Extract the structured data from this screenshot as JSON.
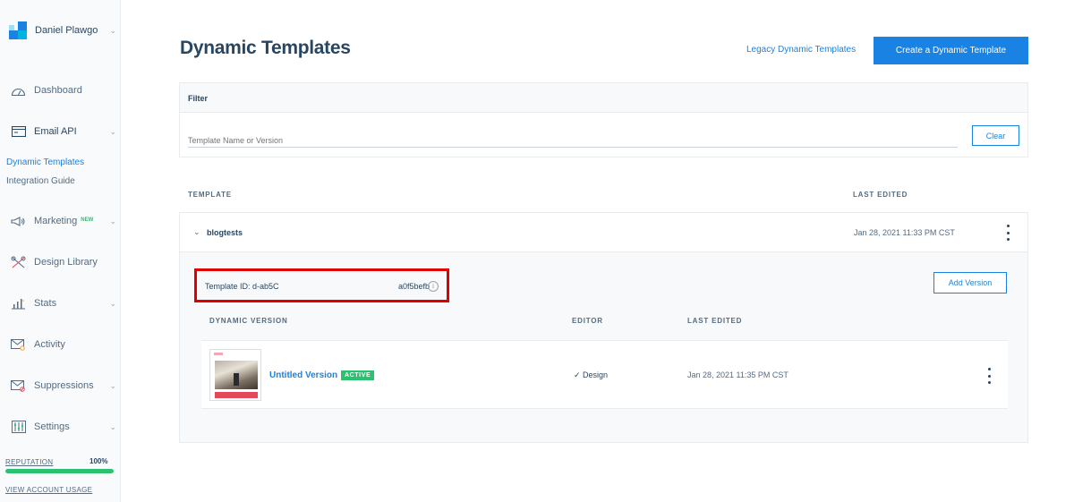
{
  "colors": {
    "accent": "#1a82e2",
    "success": "#2ac16f",
    "highlight": "#e00000",
    "text": "#294661"
  },
  "sidebar": {
    "account_name": "Daniel Plawgo",
    "items": [
      {
        "label": "Dashboard",
        "icon": "gauge-icon"
      },
      {
        "label": "Email API",
        "icon": "terminal-window-icon"
      },
      {
        "label": "Marketing",
        "icon": "megaphone-icon",
        "badge": "NEW"
      },
      {
        "label": "Design Library",
        "icon": "design-tools-icon"
      },
      {
        "label": "Stats",
        "icon": "bar-chart-icon"
      },
      {
        "label": "Activity",
        "icon": "envelope-search-icon"
      },
      {
        "label": "Suppressions",
        "icon": "envelope-blocked-icon"
      },
      {
        "label": "Settings",
        "icon": "sliders-icon"
      }
    ],
    "subitems": [
      {
        "label": "Dynamic Templates"
      },
      {
        "label": "Integration Guide"
      }
    ],
    "reputation": {
      "label": "REPUTATION",
      "value": "100%",
      "fraction": 1.0
    },
    "usage_link": "VIEW ACCOUNT USAGE"
  },
  "header": {
    "title": "Dynamic Templates",
    "legacy_link": "Legacy Dynamic Templates",
    "create_button": "Create a Dynamic Template"
  },
  "filter": {
    "title": "Filter",
    "placeholder": "Template Name or Version",
    "clear_button": "Clear"
  },
  "list": {
    "col_template": "TEMPLATE",
    "col_last_edited": "LAST EDITED",
    "templates": [
      {
        "name": "blogtests",
        "last_edited": "Jan 28, 2021 11:33 PM CST",
        "template_id_label": "Template ID: d-ab5C",
        "template_id_tail": "a0f5befb",
        "add_version_button": "Add Version",
        "version_columns": {
          "version": "DYNAMIC VERSION",
          "editor": "EDITOR",
          "last_edited": "LAST EDITED"
        },
        "versions": [
          {
            "name": "Untitled Version",
            "status": "ACTIVE",
            "editor": "✓ Design",
            "last_edited": "Jan 28, 2021 11:35 PM CST"
          }
        ]
      }
    ]
  }
}
